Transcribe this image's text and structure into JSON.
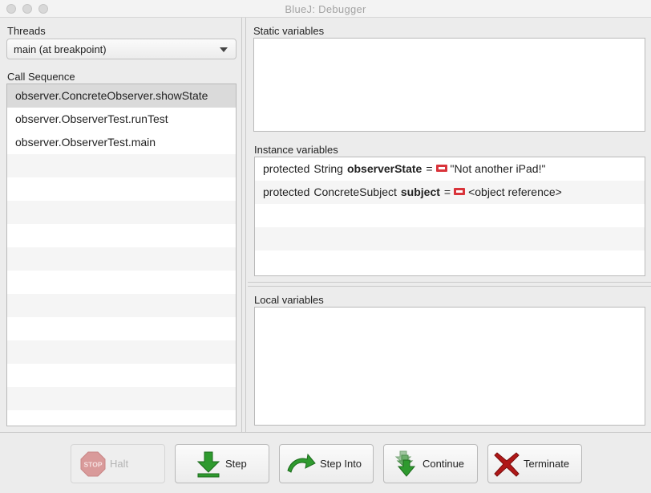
{
  "window": {
    "title": "BlueJ:  Debugger"
  },
  "threads": {
    "label": "Threads",
    "selected": "main (at breakpoint)"
  },
  "call_sequence": {
    "label": "Call Sequence",
    "items": [
      "observer.ConcreteObserver.showState",
      "observer.ObserverTest.runTest",
      "observer.ObserverTest.main"
    ]
  },
  "static_variables": {
    "label": "Static variables"
  },
  "instance_variables": {
    "label": "Instance variables",
    "items": [
      {
        "modifier": "protected",
        "type": "String",
        "name": "observerState",
        "equals": "=",
        "value": "\"Not another iPad!\""
      },
      {
        "modifier": "protected",
        "type": "ConcreteSubject",
        "name": "subject",
        "equals": "=",
        "value": "<object reference>"
      }
    ]
  },
  "local_variables": {
    "label": "Local variables"
  },
  "toolbar": {
    "halt": "Halt",
    "halt_icon_text": "STOP",
    "step": "Step",
    "step_into": "Step Into",
    "continue": "Continue",
    "terminate": "Terminate"
  },
  "colors": {
    "accent_green": "#2e9a2e",
    "terminate_red": "#b01818",
    "object_icon_red": "#d9343b",
    "selection": "#dadada"
  },
  "icons": {
    "halt": "stop-sign-icon",
    "step": "step-arrow-down-icon",
    "step_into": "curved-arrow-icon",
    "continue": "continue-arrows-icon",
    "terminate": "red-x-icon",
    "variable_object": "object-reference-icon"
  }
}
